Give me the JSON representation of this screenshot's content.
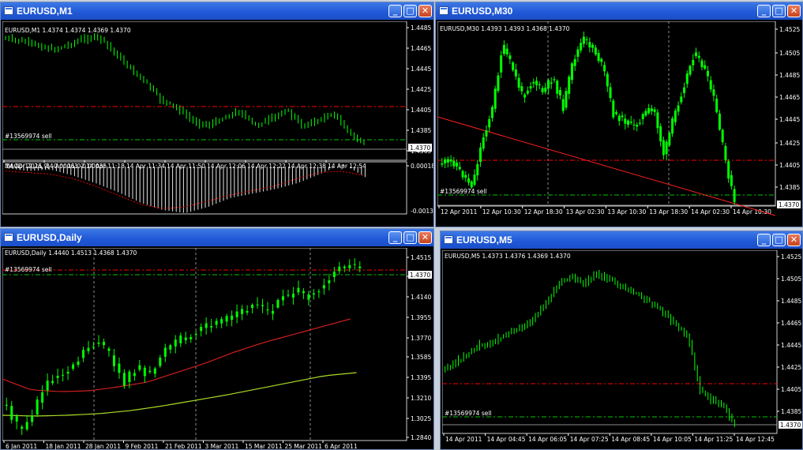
{
  "colors": {
    "candle_up": "#00ff00",
    "bg": "#000000",
    "grid_fg": "#ffffff",
    "level_red": "#ff0000",
    "level_green": "#00c800",
    "ma_red": "#d21e1e",
    "ma_yellow": "#aadc28",
    "trendline": "#ff2020"
  },
  "icons": {
    "window": "chart-window-icon",
    "minimize": "minimize-icon",
    "maximize": "maximize-icon",
    "close": "close-icon"
  },
  "windows": {
    "m1": {
      "title": "EURUSD,M1",
      "info": "EURUSD,M1  1.4374 1.4374 1.4369 1.4370",
      "order_label": "#13569974 sell",
      "price_label": "1.4370",
      "price_ticks": [
        "1.4485",
        "1.4465",
        "1.4445",
        "1.4425",
        "1.4405",
        "1.4385",
        "1.4365"
      ],
      "macd_label": "MACD(12,26,9) -0.00061 -0.00035",
      "macd_ticks": [
        "0.00018",
        "-0.00132"
      ],
      "time_ticks": [
        "14 Apr 2011",
        "14 Apr 11:02",
        "14 Apr 11:18",
        "14 Apr 11:34",
        "14 Apr 11:50",
        "14 Apr 12:06",
        "14 Apr 12:22",
        "14 Apr 12:38",
        "14 Apr 12:54"
      ]
    },
    "m30": {
      "title": "EURUSD,M30",
      "info": "EURUSD,M30  1.4393 1.4393 1.4368 1.4370",
      "order_label": "#13569974 sell",
      "price_label": "1.4370",
      "price_ticks": [
        "1.4525",
        "1.4505",
        "1.4485",
        "1.4465",
        "1.4445",
        "1.4425",
        "1.4405",
        "1.4385"
      ],
      "time_ticks": [
        "12 Apr 2011",
        "12 Apr 10:30",
        "12 Apr 18:30",
        "13 Apr 02:30",
        "13 Apr 10:30",
        "13 Apr 18:30",
        "14 Apr 02:30",
        "14 Apr 10:30"
      ]
    },
    "daily": {
      "title": "EURUSD,Daily",
      "info": "EURUSD,Daily  1.4440 1.4513 1.4368 1.4370",
      "order_label": "#13569974 sell",
      "price_label": "1.4370",
      "price_ticks": [
        "1.4515",
        "1.4325",
        "1.4140",
        "1.3955",
        "1.3770",
        "1.3585",
        "1.3395",
        "1.3210",
        "1.3025",
        "1.2840"
      ],
      "time_ticks": [
        "6 Jan 2011",
        "18 Jan 2011",
        "28 Jan 2011",
        "9 Feb 2011",
        "21 Feb 2011",
        "3 Mar 2011",
        "15 Mar 2011",
        "25 Mar 2011",
        "6 Apr 2011"
      ]
    },
    "m5": {
      "title": "EURUSD,M5",
      "info": "EURUSD,M5  1.4373 1.4376 1.4369 1.4370",
      "order_label": "#13569974 sell",
      "price_label": "1.4370",
      "price_ticks": [
        "1.4525",
        "1.4505",
        "1.4485",
        "1.4465",
        "1.4445",
        "1.4425",
        "1.4405",
        "1.4385"
      ],
      "time_ticks": [
        "14 Apr 2011",
        "14 Apr 04:45",
        "14 Apr 06:05",
        "14 Apr 07:25",
        "14 Apr 08:45",
        "14 Apr 10:05",
        "14 Apr 11:25",
        "14 Apr 12:45"
      ]
    }
  }
}
